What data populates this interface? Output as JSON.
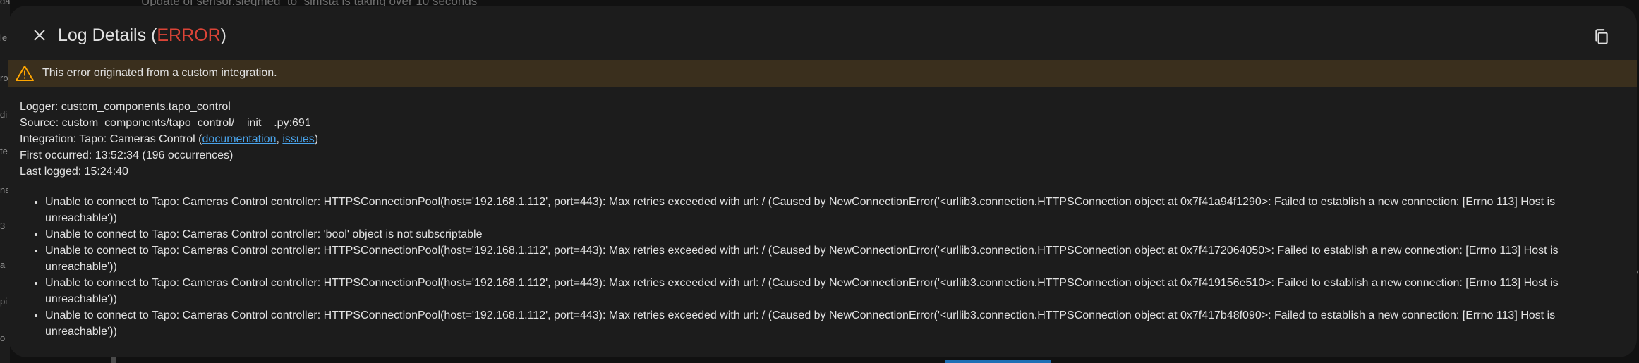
{
  "background": {
    "top_text": "Update of sensor.siegmed_to_sinfsta is taking over 10 seconds",
    "sidebar_fragments": [
      "dar",
      "le",
      "ro",
      "di",
      "te",
      "na",
      "3",
      "a",
      "pi",
      "o"
    ],
    "right_fragment": "V"
  },
  "dialog": {
    "title_prefix": "Log Details (",
    "level": "ERROR",
    "title_suffix": ")",
    "close_icon": "close-icon",
    "copy_icon": "copy-icon"
  },
  "warning": {
    "icon": "warning-icon",
    "text": "This error originated from a custom integration."
  },
  "details": {
    "logger_label": "Logger: ",
    "logger": "custom_components.tapo_control",
    "source_label": "Source: ",
    "source": "custom_components/tapo_control/__init__.py:691",
    "integration_label": "Integration: ",
    "integration": "Tapo: Cameras Control",
    "open_paren": " (",
    "documentation_link": "documentation",
    "comma": ", ",
    "issues_link": "issues",
    "close_paren": ")",
    "first_occurred_label": "First occurred: ",
    "first_occurred": "13:52:34 (196 occurrences)",
    "last_logged_label": "Last logged: ",
    "last_logged": "15:24:40"
  },
  "messages": [
    "Unable to connect to Tapo: Cameras Control controller: HTTPSConnectionPool(host='192.168.1.112', port=443): Max retries exceeded with url: / (Caused by NewConnectionError('<urllib3.connection.HTTPSConnection object at 0x7f41a94f1290>: Failed to establish a new connection: [Errno 113] Host is unreachable'))",
    "Unable to connect to Tapo: Cameras Control controller: 'bool' object is not subscriptable",
    "Unable to connect to Tapo: Cameras Control controller: HTTPSConnectionPool(host='192.168.1.112', port=443): Max retries exceeded with url: / (Caused by NewConnectionError('<urllib3.connection.HTTPSConnection object at 0x7f4172064050>: Failed to establish a new connection: [Errno 113] Host is unreachable'))",
    "Unable to connect to Tapo: Cameras Control controller: HTTPSConnectionPool(host='192.168.1.112', port=443): Max retries exceeded with url: / (Caused by NewConnectionError('<urllib3.connection.HTTPSConnection object at 0x7f419156e510>: Failed to establish a new connection: [Errno 113] Host is unreachable'))",
    "Unable to connect to Tapo: Cameras Control controller: HTTPSConnectionPool(host='192.168.1.112', port=443): Max retries exceeded with url: / (Caused by NewConnectionError('<urllib3.connection.HTTPSConnection object at 0x7f417b48f090>: Failed to establish a new connection: [Errno 113] Host is unreachable'))"
  ],
  "colors": {
    "error": "#db4437",
    "warning_bg": "#3a2f1d",
    "warning_icon": "#ffa600",
    "link": "#4aa3ea",
    "dialog_bg": "#1c1c1c",
    "text": "#e1e1e1"
  }
}
